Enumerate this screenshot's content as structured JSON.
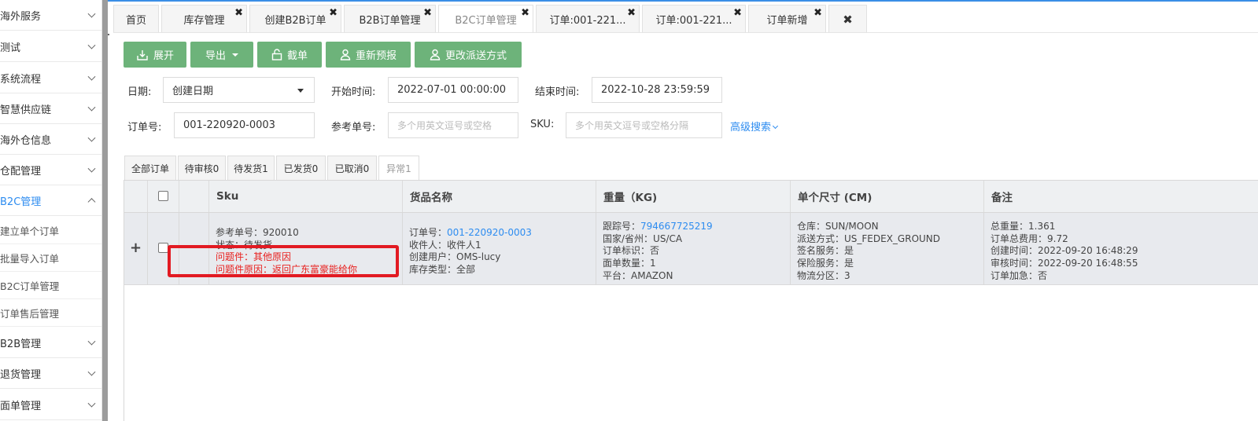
{
  "sidebar": {
    "menus": [
      {
        "label": "海外服务"
      },
      {
        "label": "测试"
      },
      {
        "label": "系统流程"
      },
      {
        "label": "智慧供应链"
      },
      {
        "label": "海外仓信息"
      },
      {
        "label": "仓配管理"
      },
      {
        "label": "B2C管理"
      }
    ],
    "submenus": [
      {
        "label": "建立单个订单"
      },
      {
        "label": "批量导入订单"
      },
      {
        "label": "B2C订单管理"
      },
      {
        "label": "订单售后管理"
      }
    ],
    "menus_after": [
      {
        "label": "B2B管理"
      },
      {
        "label": "退货管理"
      },
      {
        "label": "面单管理"
      }
    ]
  },
  "tabs": [
    {
      "label": "首页"
    },
    {
      "label": "库存管理"
    },
    {
      "label": "创建B2B订单"
    },
    {
      "label": "B2B订单管理"
    },
    {
      "label": "B2C订单管理"
    },
    {
      "label": "订单:001-221..."
    },
    {
      "label": "订单:001-221..."
    },
    {
      "label": "订单新增"
    }
  ],
  "toolbar": {
    "expand": "展开",
    "export": "导出",
    "intercept": "截单",
    "reforecast": "重新预报",
    "change_delivery": "更改派送方式"
  },
  "filters": {
    "date_label": "日期:",
    "date_type": "创建日期",
    "start_label": "开始时间:",
    "start_value": "2022-07-01 00:00:00",
    "end_label": "结束时间:",
    "end_value": "2022-10-28 23:59:59",
    "order_label": "订单号:",
    "order_value": "001-220920-0003",
    "ref_label": "参考单号:",
    "ref_placeholder": "多个用英文逗号或空格",
    "sku_label": "SKU:",
    "sku_placeholder": "多个用英文逗号或空格分隔",
    "advanced": "高级搜索"
  },
  "status_tabs": [
    {
      "label": "全部订单"
    },
    {
      "label": "待审核0"
    },
    {
      "label": "待发货1"
    },
    {
      "label": "已发货0"
    },
    {
      "label": "已取消0"
    },
    {
      "label": "异常1"
    }
  ],
  "table": {
    "headers": {
      "sku": "Sku",
      "goods": "货品名称",
      "weight": "重量（KG)",
      "size": "单个尺寸 (CM)",
      "remark": "备注"
    },
    "row": {
      "col1": {
        "ref": "参考单号：920010",
        "status": "状态：待发货",
        "issue1": "问题件：其他原因",
        "issue2": "问题件原因：返回广东富豪能给你"
      },
      "col2": {
        "order_label": "订单号：",
        "order_value": "001-220920-0003",
        "receiver": "收件人：收件人1",
        "creator": "创建用户：OMS-lucy",
        "stock_type": "库存类型：全部"
      },
      "col3": {
        "tracking_label": "跟踪号：",
        "tracking_value": "794667725219",
        "country": "国家/省州：US/CA",
        "order_flag": "订单标识：否",
        "labels": "面单数量：1",
        "platform": "平台：AMAZON"
      },
      "col4": {
        "warehouse": "仓库：SUN/MOON",
        "delivery": "派送方式：US_FEDEX_GROUND",
        "signature": "签名服务：是",
        "insurance": "保险服务：是",
        "zone": "物流分区：3"
      },
      "col5": {
        "total_weight": "总重量：1.361",
        "total_fee": "订单总费用：9.72",
        "created": "创建时间：2022-09-20 16:48:29",
        "reviewed": "审核时间：2022-09-20 16:48:55",
        "urgent": "订单加急：否"
      }
    }
  },
  "colors": {
    "button_green": "#6db37a",
    "link_blue": "#2d8cf0",
    "error_red": "#e8201e",
    "highlight_red": "#e21a22"
  }
}
